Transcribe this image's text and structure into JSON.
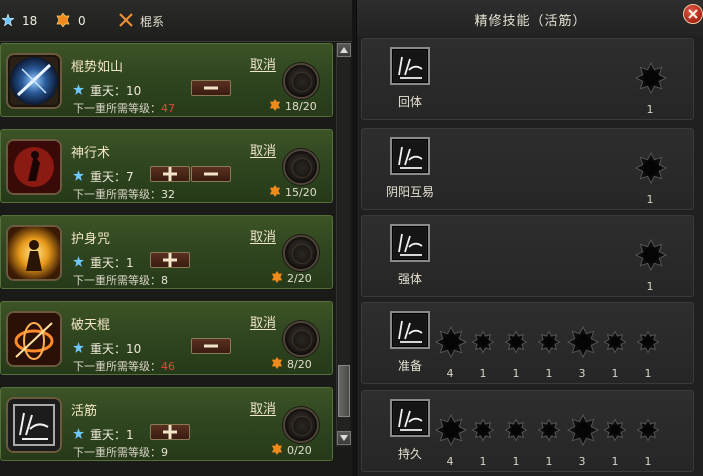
{
  "topbar": {
    "skill_points": "18",
    "gold_points": "0",
    "category_label": "棍系"
  },
  "skills": [
    {
      "name": "棍势如山",
      "cancel": "取消",
      "level": "重天：10",
      "required_prefix": "下一重所需等级：",
      "required_level": "47",
      "required_red": true,
      "points": "18/20",
      "icon": "staff-mountain-icon",
      "buttons": [
        "minus"
      ]
    },
    {
      "name": "神行术",
      "cancel": "取消",
      "level": "重天：7",
      "required_prefix": "下一重所需等级：",
      "required_level": "32",
      "required_red": false,
      "points": "15/20",
      "icon": "divine-travel-icon",
      "buttons": [
        "plus",
        "minus"
      ]
    },
    {
      "name": "护身咒",
      "cancel": "取消",
      "level": "重天：1",
      "required_prefix": "下一重所需等级：",
      "required_level": "8",
      "required_red": false,
      "points": "2/20",
      "icon": "shield-spell-icon",
      "buttons": [
        "plus"
      ]
    },
    {
      "name": "破天棍",
      "cancel": "取消",
      "level": "重天：10",
      "required_prefix": "下一重所需等级：",
      "required_level": "46",
      "required_red": true,
      "points": "8/20",
      "icon": "sky-break-icon",
      "buttons": [
        "minus"
      ]
    },
    {
      "name": "活筋",
      "cancel": "取消",
      "level": "重天：1",
      "required_prefix": "下一重所需等级：",
      "required_level": "9",
      "required_red": false,
      "points": "0/20",
      "icon": "tendon-icon",
      "buttons": [
        "plus"
      ]
    }
  ],
  "refine": {
    "title": "精修技能（活筋）",
    "rows": [
      {
        "name": "回体",
        "slots": [
          1
        ]
      },
      {
        "name": "阴阳互易",
        "slots": [
          1
        ]
      },
      {
        "name": "强体",
        "slots": [
          1
        ]
      },
      {
        "name": "准备",
        "slots": [
          4,
          1,
          1,
          1,
          3,
          1,
          1
        ]
      },
      {
        "name": "持久",
        "slots": [
          4,
          1,
          1,
          1,
          3,
          1,
          1
        ]
      }
    ]
  },
  "colors": {
    "skill_row_bg": "#304620",
    "required_red": "#e0483a",
    "close_button": "#a82416"
  }
}
